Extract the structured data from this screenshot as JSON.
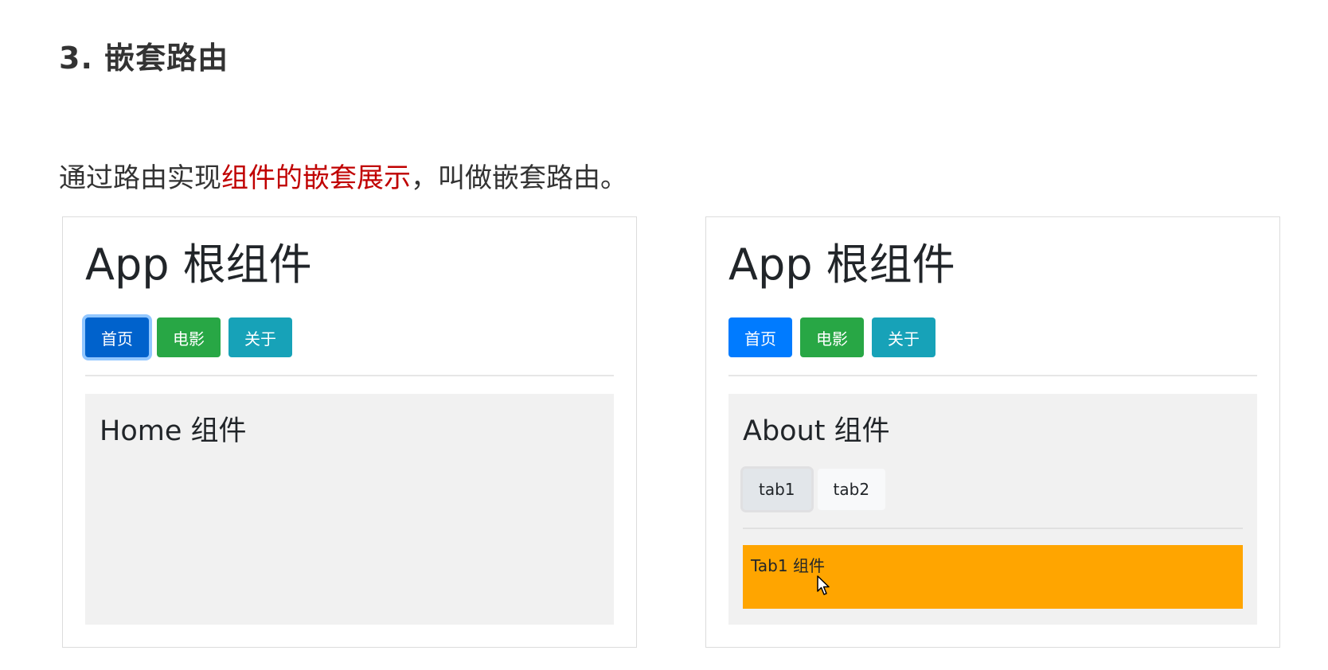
{
  "heading": "3. 嵌套路由",
  "intro": {
    "before": "通过路由实现",
    "highlight": "组件的嵌套展示",
    "after": "，叫做嵌套路由。"
  },
  "colors": {
    "highlight": "#c00000",
    "primary": "#007bff",
    "success": "#28a745",
    "info": "#17a2b8",
    "tab_content_bg": "#ffa500",
    "content_bg": "#f1f1f1"
  },
  "panels": [
    {
      "app_title": "App 根组件",
      "nav": [
        "首页",
        "电影",
        "关于"
      ],
      "active_nav": 0,
      "component_title": "Home 组件"
    },
    {
      "app_title": "App 根组件",
      "nav": [
        "首页",
        "电影",
        "关于"
      ],
      "active_nav": null,
      "component_title": "About 组件",
      "tabs": [
        "tab1",
        "tab2"
      ],
      "active_tab": 0,
      "tab_content": "Tab1 组件"
    }
  ],
  "icons": [
    "mouse-cursor-icon"
  ]
}
